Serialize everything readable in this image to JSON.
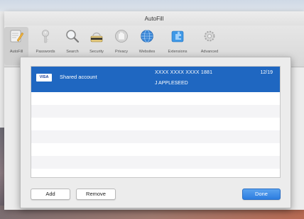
{
  "window": {
    "title": "AutoFill"
  },
  "toolbar": {
    "items": [
      {
        "label": "AutoFill",
        "icon": "autofill-pencil-icon",
        "active": true
      },
      {
        "label": "Passwords",
        "icon": "key-icon",
        "active": false
      },
      {
        "label": "Search",
        "icon": "magnifier-icon",
        "active": false
      },
      {
        "label": "Security",
        "icon": "security-icon",
        "active": false
      },
      {
        "label": "Privacy",
        "icon": "privacy-hand-icon",
        "active": false
      },
      {
        "label": "Websites",
        "icon": "globe-icon",
        "active": false
      },
      {
        "label": "Extensions",
        "icon": "puzzle-icon",
        "active": false
      },
      {
        "label": "Advanced",
        "icon": "gear-icon",
        "active": false
      }
    ]
  },
  "cards": [
    {
      "badge": "VISA",
      "description": "Shared account",
      "number": "XXXX XXXX XXXX 1881",
      "name": "J APPLESEED",
      "expiry": "12/19",
      "selected": true
    }
  ],
  "buttons": {
    "add": "Add",
    "remove": "Remove",
    "done": "Done"
  },
  "colors": {
    "selection": "#1f67c1",
    "done_button": "#2c7de0"
  }
}
